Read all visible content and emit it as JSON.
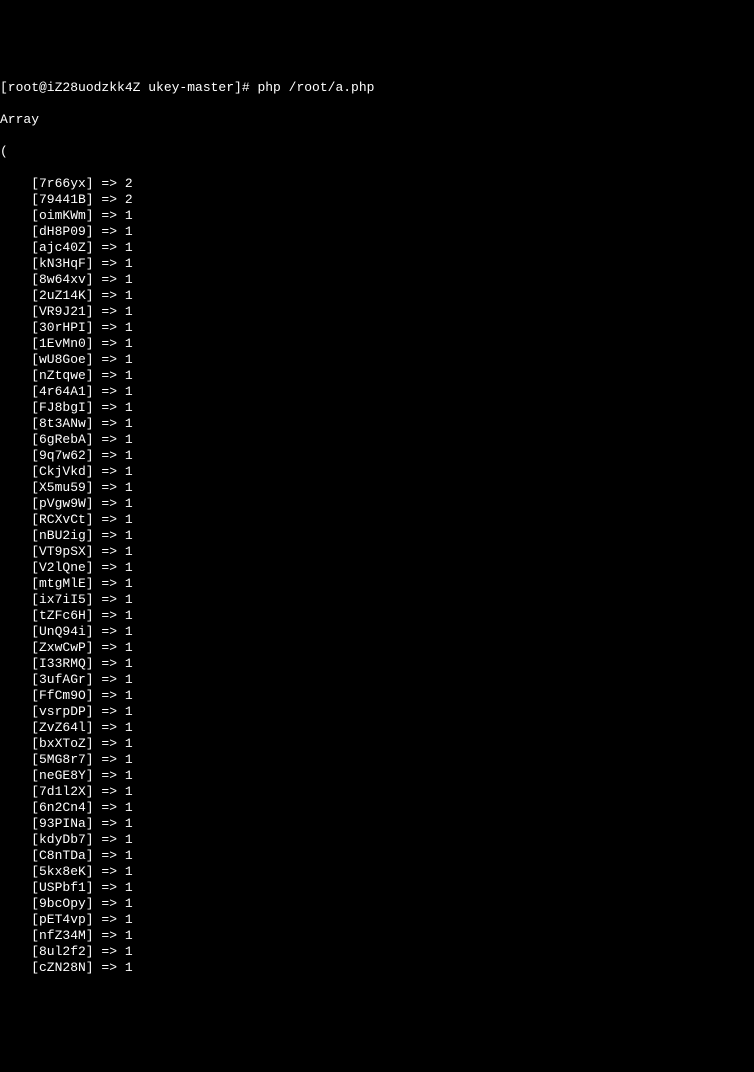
{
  "prompt": "[root@iZ28uodzkk4Z ukey-master]# php /root/a.php",
  "output_header": "Array",
  "open_paren": "(",
  "entries": [
    {
      "key": "7r66yx",
      "value": "2"
    },
    {
      "key": "79441B",
      "value": "2"
    },
    {
      "key": "oimKWm",
      "value": "1"
    },
    {
      "key": "dH8P09",
      "value": "1"
    },
    {
      "key": "ajc40Z",
      "value": "1"
    },
    {
      "key": "kN3HqF",
      "value": "1"
    },
    {
      "key": "8w64xv",
      "value": "1"
    },
    {
      "key": "2uZ14K",
      "value": "1"
    },
    {
      "key": "VR9J21",
      "value": "1"
    },
    {
      "key": "30rHPI",
      "value": "1"
    },
    {
      "key": "1EvMn0",
      "value": "1"
    },
    {
      "key": "wU8Goe",
      "value": "1"
    },
    {
      "key": "nZtqwe",
      "value": "1"
    },
    {
      "key": "4r64A1",
      "value": "1"
    },
    {
      "key": "FJ8bgI",
      "value": "1"
    },
    {
      "key": "8t3ANw",
      "value": "1"
    },
    {
      "key": "6gRebA",
      "value": "1"
    },
    {
      "key": "9q7w62",
      "value": "1"
    },
    {
      "key": "CkjVkd",
      "value": "1"
    },
    {
      "key": "X5mu59",
      "value": "1"
    },
    {
      "key": "pVgw9W",
      "value": "1"
    },
    {
      "key": "RCXvCt",
      "value": "1"
    },
    {
      "key": "nBU2ig",
      "value": "1"
    },
    {
      "key": "VT9pSX",
      "value": "1"
    },
    {
      "key": "V2lQne",
      "value": "1"
    },
    {
      "key": "mtgMlE",
      "value": "1"
    },
    {
      "key": "ix7iI5",
      "value": "1"
    },
    {
      "key": "tZFc6H",
      "value": "1"
    },
    {
      "key": "UnQ94i",
      "value": "1"
    },
    {
      "key": "ZxwCwP",
      "value": "1"
    },
    {
      "key": "I33RMQ",
      "value": "1"
    },
    {
      "key": "3ufAGr",
      "value": "1"
    },
    {
      "key": "FfCm9O",
      "value": "1"
    },
    {
      "key": "vsrpDP",
      "value": "1"
    },
    {
      "key": "ZvZ64l",
      "value": "1"
    },
    {
      "key": "bxXToZ",
      "value": "1"
    },
    {
      "key": "5MG8r7",
      "value": "1"
    },
    {
      "key": "neGE8Y",
      "value": "1"
    },
    {
      "key": "7d1l2X",
      "value": "1"
    },
    {
      "key": "6n2Cn4",
      "value": "1"
    },
    {
      "key": "93PINa",
      "value": "1"
    },
    {
      "key": "kdyDb7",
      "value": "1"
    },
    {
      "key": "C8nTDa",
      "value": "1"
    },
    {
      "key": "5kx8eK",
      "value": "1"
    },
    {
      "key": "USPbf1",
      "value": "1"
    },
    {
      "key": "9bcOpy",
      "value": "1"
    },
    {
      "key": "pET4vp",
      "value": "1"
    },
    {
      "key": "nfZ34M",
      "value": "1"
    },
    {
      "key": "8ul2f2",
      "value": "1"
    },
    {
      "key": "cZN28N",
      "value": "1"
    }
  ]
}
